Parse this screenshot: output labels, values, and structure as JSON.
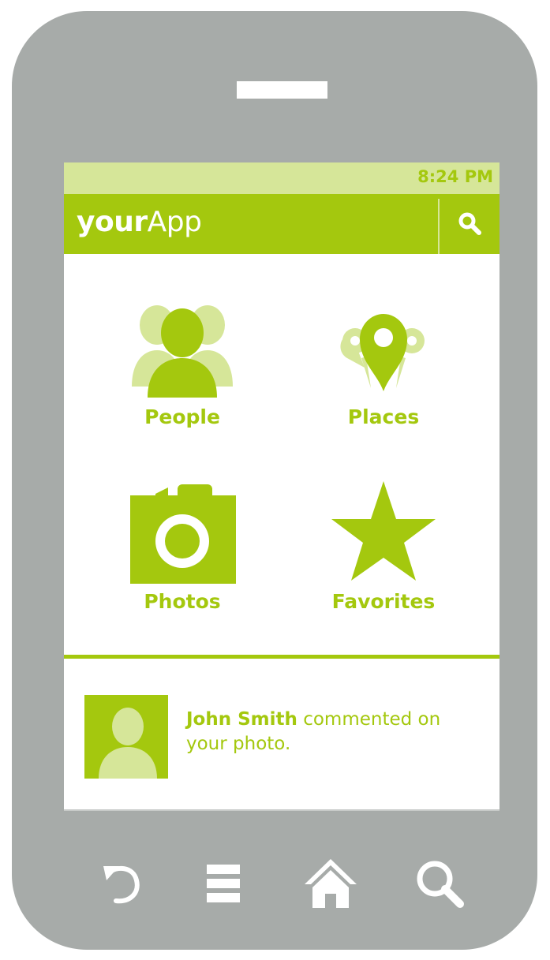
{
  "colors": {
    "accent": "#a4c80e",
    "accent_light": "#d6e699",
    "phone_body": "#a7aba9",
    "screen": "#ffffff"
  },
  "status_bar": {
    "time": "8:24 PM"
  },
  "action_bar": {
    "title_bold": "your",
    "title_regular": "App",
    "search_icon": "search-icon"
  },
  "dashboard": {
    "tiles": [
      {
        "label": "People",
        "icon": "people-icon"
      },
      {
        "label": "Places",
        "icon": "map-pin-icon"
      },
      {
        "label": "Photos",
        "icon": "camera-icon"
      },
      {
        "label": "Favorites",
        "icon": "star-icon"
      }
    ]
  },
  "notification": {
    "user": "John Smith",
    "message": " commented on your photo.",
    "avatar_icon": "avatar-icon"
  },
  "nav_bar": {
    "buttons": [
      {
        "icon": "back-icon"
      },
      {
        "icon": "menu-icon"
      },
      {
        "icon": "home-icon"
      },
      {
        "icon": "search-icon"
      }
    ]
  }
}
